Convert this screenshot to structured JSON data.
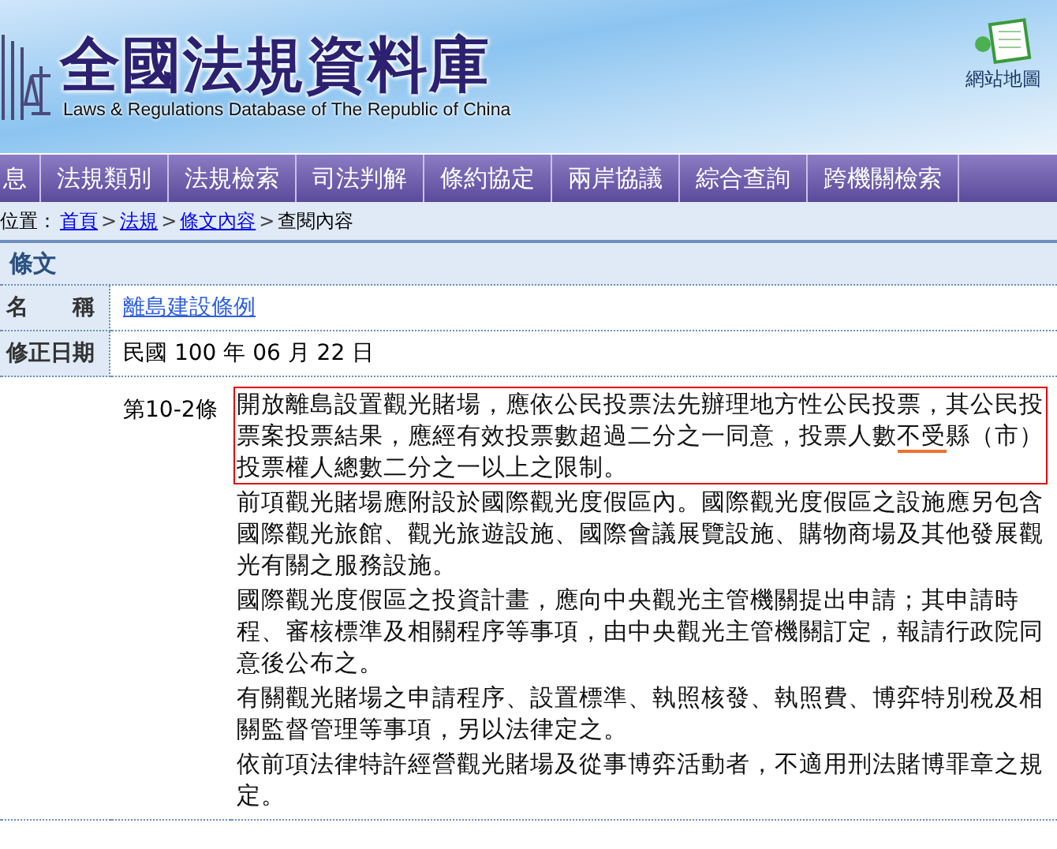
{
  "header": {
    "title": "全國法規資料庫",
    "subtitle": "Laws & Regulations Database of The Republic of China",
    "sitemap": "網站地圖"
  },
  "nav": [
    "息",
    "法規類別",
    "法規檢索",
    "司法判解",
    "條約協定",
    "兩岸協議",
    "綜合查詢",
    "跨機關檢索"
  ],
  "breadcrumb": {
    "label": "位置：",
    "links": [
      "首頁",
      "法規",
      "條文內容"
    ],
    "separator": ">",
    "current": "查閱內容"
  },
  "section_title": "條文",
  "fields": [
    {
      "label": "名　　稱",
      "value": "離島建設條例",
      "kind": "link"
    },
    {
      "label": "修正日期",
      "value": "民國 100 年 06 月 22 日",
      "kind": "text"
    }
  ],
  "article": {
    "number": "第10-2條",
    "paragraphs": [
      {
        "boxed": true,
        "parts": [
          {
            "text": "開放離島設置觀光賭場，應依公民投票法先辦理地方性公民投票，其公民投票案投票結果，應經有效投票數超過二分之一同意，投票人數",
            "underlined": false
          },
          {
            "text": "不受",
            "underlined": true
          },
          {
            "text": "縣（市）投票權人總數二分之一以上之限制。",
            "underlined": false
          }
        ]
      },
      {
        "boxed": false,
        "parts": [
          {
            "text": "前項觀光賭場應附設於國際觀光度假區內。國際觀光度假區之設施應另包含國際觀光旅館、觀光旅遊設施、國際會議展覽設施、購物商場及其他發展觀光有關之服務設施。",
            "underlined": false
          }
        ]
      },
      {
        "boxed": false,
        "parts": [
          {
            "text": "國際觀光度假區之投資計畫，應向中央觀光主管機關提出申請；其申請時程、審核標準及相關程序等事項，由中央觀光主管機關訂定，報請行政院同意後公布之。",
            "underlined": false
          }
        ]
      },
      {
        "boxed": false,
        "parts": [
          {
            "text": "有關觀光賭場之申請程序、設置標準、執照核發、執照費、博弈特別稅及相關監督管理等事項，另以法律定之。",
            "underlined": false
          }
        ]
      },
      {
        "boxed": false,
        "parts": [
          {
            "text": "依前項法律特許經營觀光賭場及從事博弈活動者，不適用刑法賭博罪章之規定。",
            "underlined": false
          }
        ]
      }
    ]
  }
}
